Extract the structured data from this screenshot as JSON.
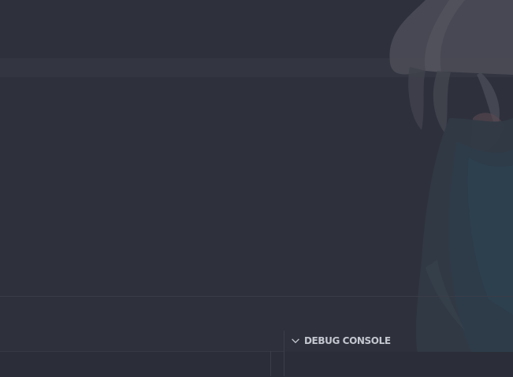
{
  "panel": {
    "debug_console": {
      "title": "DEBUG CONSOLE",
      "expanded": true,
      "icon": "chevron-down-icon"
    }
  },
  "theme": {
    "editor_background": "#2e313c",
    "panel_background": "#2b2e38",
    "header_text": "#c4c7cf",
    "border": "#3c3f4a"
  },
  "wallpaper": {
    "description_icon": "anime-character-wallpaper"
  }
}
